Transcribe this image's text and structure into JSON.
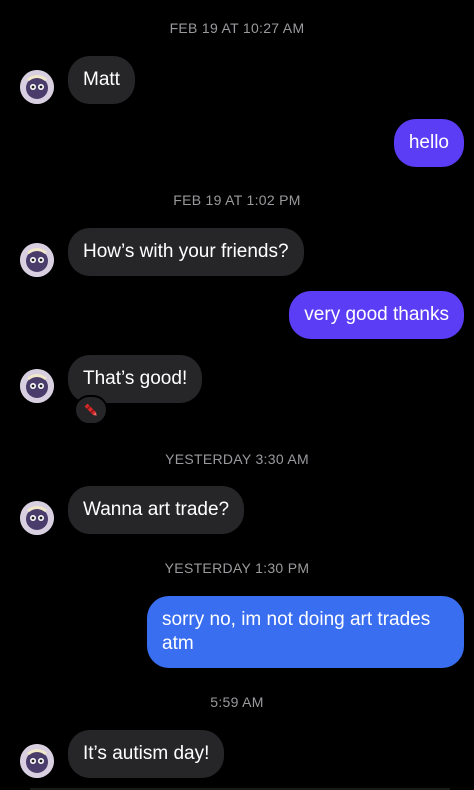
{
  "timestamps": [
    "FEB 19 AT 10:27 AM",
    "FEB 19 AT 1:02 PM",
    "YESTERDAY 3:30 AM",
    "YESTERDAY 1:30 PM",
    "5:59 AM"
  ],
  "messages": [
    {
      "text": "Matt"
    },
    {
      "text": "hello"
    },
    {
      "text": "How’s with your friends?"
    },
    {
      "text": "very good thanks"
    },
    {
      "text": "That’s good!"
    },
    {
      "text": "Wanna art trade?"
    },
    {
      "text": "sorry no, im not doing art trades atm"
    },
    {
      "text": "It’s autism day!"
    }
  ],
  "reaction": {
    "icon": "crayon-icon"
  },
  "colors": {
    "background": "#000000",
    "incoming_bubble": "#262628",
    "outgoing_purple": "#5b3df5",
    "outgoing_blue": "#3a6ef0",
    "timestamp_text": "#9a9a9e"
  }
}
